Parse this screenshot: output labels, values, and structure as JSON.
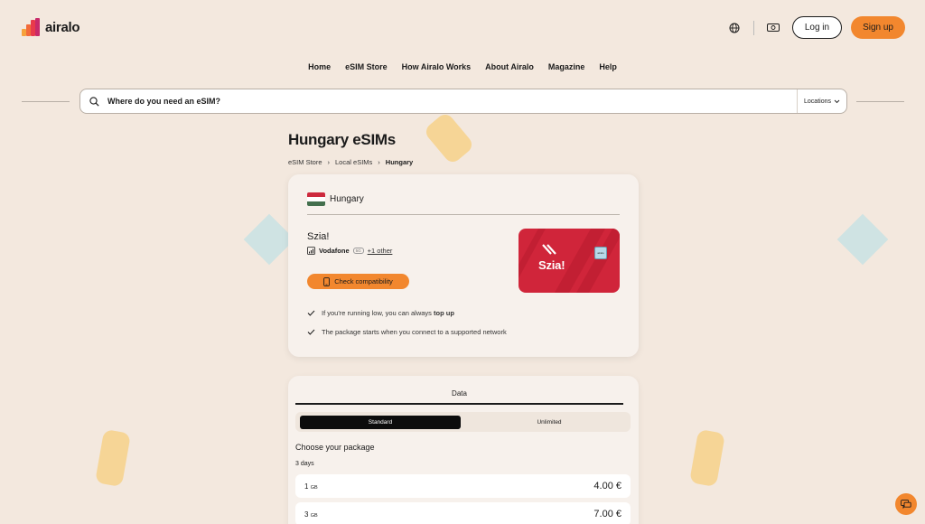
{
  "brand": {
    "name": "airalo",
    "accent": "#f2872e"
  },
  "header": {
    "language_icon": "globe-icon",
    "currency_icon": "currency-icon",
    "login_label": "Log in",
    "signup_label": "Sign up"
  },
  "nav": {
    "items": [
      "Home",
      "eSIM Store",
      "How Airalo Works",
      "About Airalo",
      "Magazine",
      "Help"
    ]
  },
  "search": {
    "placeholder": "Where do you need an eSIM?",
    "locations_label": "Locations"
  },
  "page": {
    "title": "Hungary eSIMs"
  },
  "breadcrumb": {
    "items": [
      "eSIM Store",
      "Local eSIMs",
      "Hungary"
    ]
  },
  "esim_card": {
    "country": "Hungary",
    "operator_name": "Szia!",
    "network": "Vodafone",
    "network_badge": "5G",
    "other_link": "+1 other",
    "check_button": "Check compatibility",
    "card_brand": "Szia!",
    "card_chip_label": "airalo",
    "features": [
      {
        "text": "If you're running low, you can always ",
        "bold": "top up"
      },
      {
        "text": "The package starts when you connect to a supported network",
        "bold": ""
      }
    ]
  },
  "packages": {
    "tab_label": "Data",
    "segment_standard": "Standard",
    "segment_unlimited": "Unlimited",
    "choose_label": "Choose your package",
    "duration": "3 days",
    "items": [
      {
        "amount": "1",
        "unit": "GB",
        "price": "4.00 €"
      },
      {
        "amount": "3",
        "unit": "GB",
        "price": "7.00 €"
      }
    ]
  },
  "chat": {
    "icon": "chat-icon"
  }
}
